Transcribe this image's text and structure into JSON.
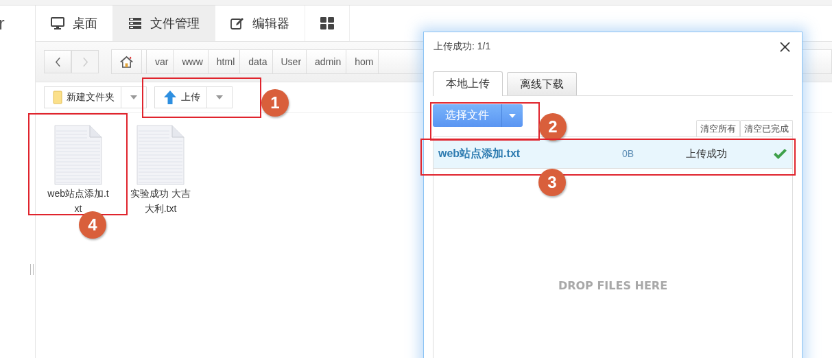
{
  "sidebar": {
    "label": "r"
  },
  "nav_tabs": [
    {
      "kind": "monitor",
      "label": "桌面",
      "selected": false
    },
    {
      "kind": "server",
      "label": "文件管理",
      "selected": true
    },
    {
      "kind": "edit",
      "label": "编辑器",
      "selected": false
    },
    {
      "kind": "grid",
      "selected": false
    }
  ],
  "breadcrumb": [
    "var",
    "www",
    "html",
    "data",
    "User",
    "admin",
    "hom"
  ],
  "toolbar": [
    {
      "kind": "folder",
      "label": "新建文件夹"
    },
    {
      "kind": "upload",
      "label": "上传"
    }
  ],
  "files": [
    {
      "name": "web站点添加.txt"
    },
    {
      "name": "实验成功 大吉大利.txt"
    }
  ],
  "dialog": {
    "title": "上传成功: 1/1",
    "tabs": [
      {
        "label": "本地上传",
        "selected": true
      },
      {
        "label": "离线下载",
        "selected": false
      }
    ],
    "choose_button": "选择文件",
    "clear_buttons": [
      "清空所有",
      "清空已完成"
    ],
    "uploads": [
      {
        "name": "web站点添加.txt",
        "size": "0B",
        "status": "上传成功",
        "done": true
      }
    ],
    "drop_hint": "DROP FILES HERE"
  },
  "annotations": [
    "1",
    "2",
    "3",
    "4"
  ]
}
